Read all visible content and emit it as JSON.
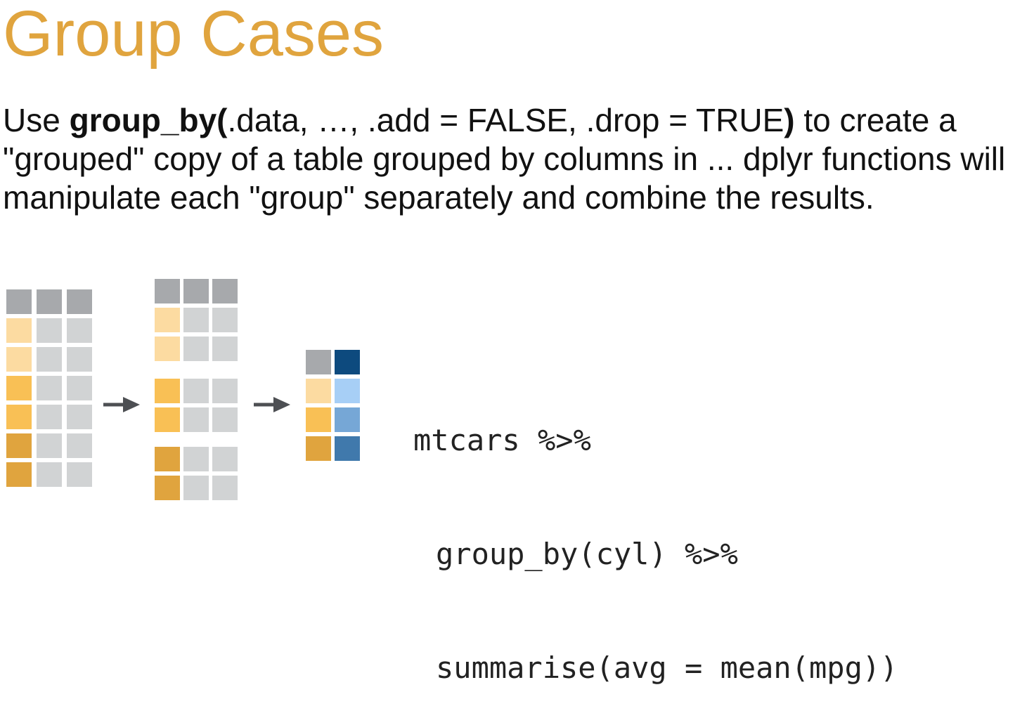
{
  "title": "Group Cases",
  "description": {
    "intro": "Use ",
    "fn_name": "group_by(",
    "args": ".data, …, .add = FALSE, .drop = TRUE",
    "close": ")",
    "rest": " to create a \"grouped\" copy of a table grouped by columns in ... dplyr functions will manipulate each \"group\" separately and combine the results."
  },
  "colors": {
    "title": "#e0a43e",
    "header_gray": "#a7a9ac",
    "cell_gray": "#d1d3d4",
    "group_light": "#fcdba1",
    "group_mid": "#f9c055",
    "group_dark": "#e0a43e",
    "summary_header": "#0d4a7e",
    "summary_1": "#a7cff6",
    "summary_2": "#76a7d6",
    "summary_3": "#4079ac",
    "arrow": "#4d4f53"
  },
  "code": {
    "line1": "mtcars %>%",
    "line2": "group_by(cyl) %>%",
    "line3": "summarise(avg = mean(mpg))"
  }
}
